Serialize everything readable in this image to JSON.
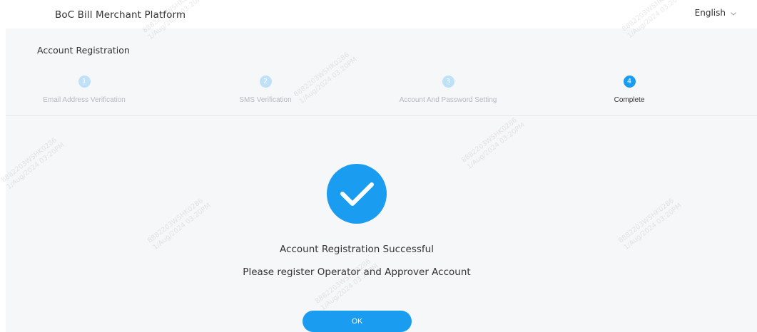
{
  "header": {
    "brand": "BoC Bill Merchant Platform",
    "language": "English",
    "language_icon": "chevron-down-icon"
  },
  "registration": {
    "title": "Account Registration",
    "steps": [
      {
        "number": "1",
        "label": "Email Address Verification",
        "active": false
      },
      {
        "number": "2",
        "label": "SMS Verification",
        "active": false
      },
      {
        "number": "3",
        "label": "Account And Password Setting",
        "active": false
      },
      {
        "number": "4",
        "label": "Complete",
        "active": true
      }
    ]
  },
  "result": {
    "icon": "check-circle-icon",
    "title": "Account Registration Successful",
    "subtitle": "Please register Operator and Approver Account",
    "ok_label": "OK"
  },
  "watermark": {
    "line1": "8882203WSHK0286",
    "line2": "1/Aug/2024 03:20PM"
  },
  "colors": {
    "accent": "#1a9cf0",
    "step_inactive": "#bfe1f7",
    "background": "#f6f7f9"
  }
}
